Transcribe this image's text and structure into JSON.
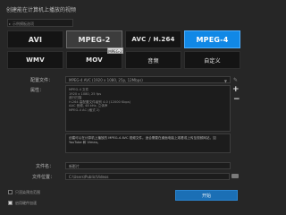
{
  "dialog": {
    "title": "创建能在计算机上播放的视频"
  },
  "top_select": {
    "value": "示例模板选项"
  },
  "formats": {
    "row1": [
      "AVI",
      "MPEG-2",
      "AVC / H.264",
      "MPEG-4"
    ],
    "row2": [
      "WMV",
      "MOV",
      "音频",
      "自定义"
    ],
    "selected": "MPEG-4",
    "hovered": "MPEG-2",
    "tooltip": "MPEG-2"
  },
  "profile": {
    "label": "配置文件：",
    "value": "MPEG-4 AVC (1920 x 1080, 25p, 12Mbps)"
  },
  "attributes": {
    "label": "属性：",
    "lines": [
      "MPEG-4 文件",
      "1920 x 1080, 25 fps",
      "逐行扫描",
      "H.264 高配置文件级别 4.0 (12000 Kbps)",
      "AAC 音频, 48 kHz, 立体声",
      "MPEG-4 AC (格式 2)"
    ]
  },
  "description": {
    "text": "创建可以在计算机上播放的 MPEG-4 AVC 视频文件。适合需要在桌面电脑上观看或上传至视频网站，如 YouTube 和 Vimeo。"
  },
  "file_name": {
    "label": "文件名：",
    "value": "新影片"
  },
  "file_location": {
    "label": "文件位置：",
    "value": "C:\\Users\\Public\\Videos"
  },
  "options": {
    "only_render_selection": "只渲染预览范围",
    "show_in_folder": "启用硬件加速"
  },
  "buttons": {
    "start": "开始"
  }
}
